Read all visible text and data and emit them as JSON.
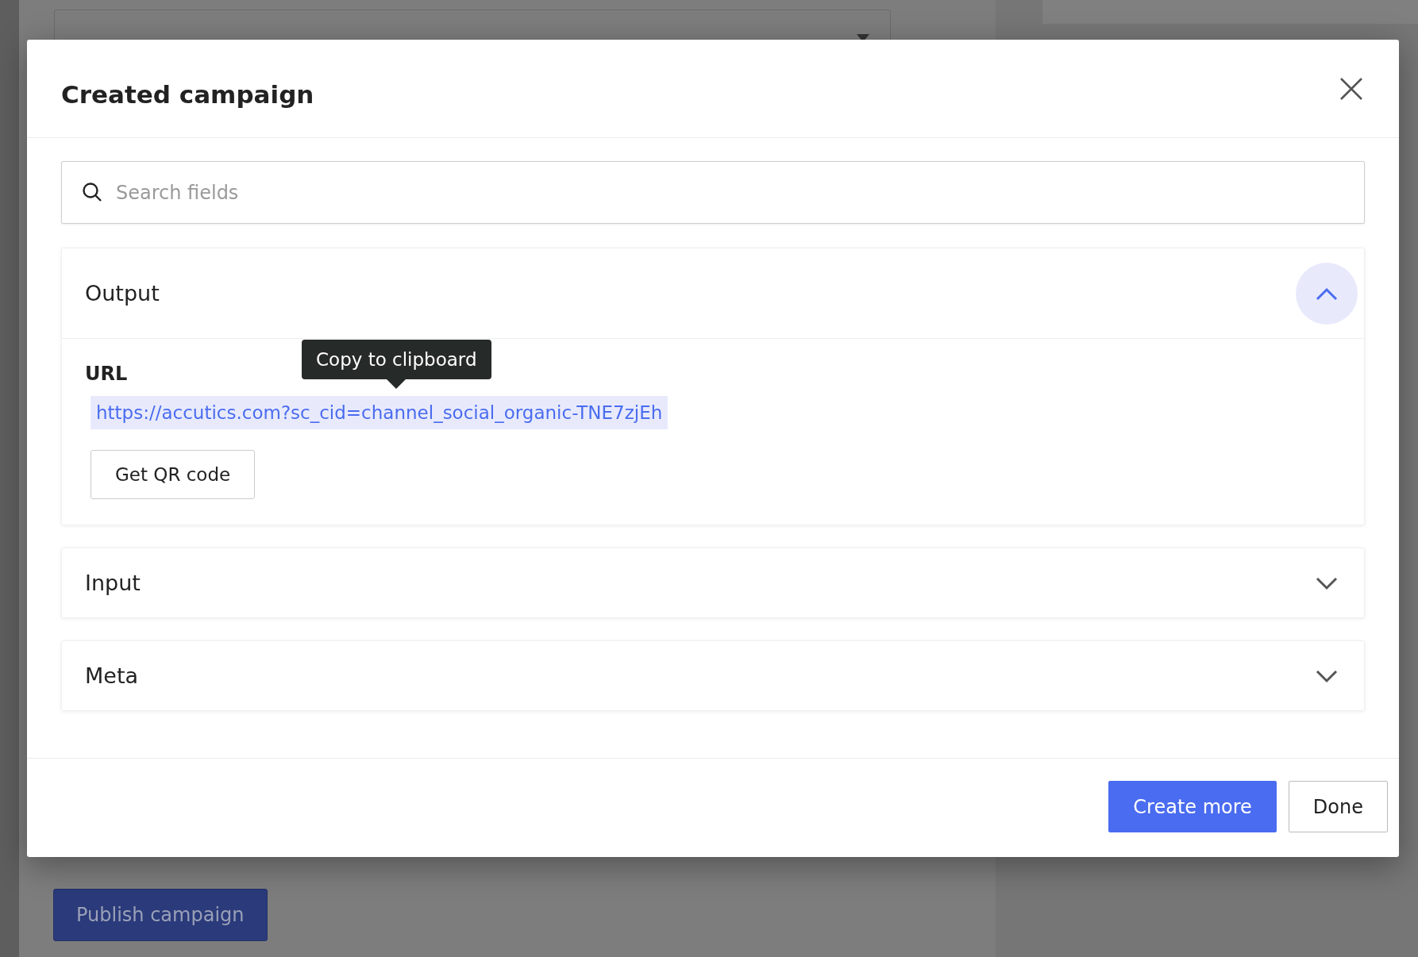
{
  "background": {
    "publish_button": "Publish campaign"
  },
  "dialog": {
    "title": "Created campaign",
    "search": {
      "placeholder": "Search fields"
    },
    "sections": [
      {
        "title": "Output",
        "expanded": true,
        "field_label": "URL",
        "url": "https://accutics.com?sc_cid=channel_social_organic-TNE7zjEh",
        "tooltip": "Copy to clipboard",
        "qr_button": "Get QR code"
      },
      {
        "title": "Input",
        "expanded": false
      },
      {
        "title": "Meta",
        "expanded": false
      }
    ],
    "buttons": [
      {
        "label": "Create more",
        "kind": "primary"
      },
      {
        "label": "Done",
        "kind": "secondary"
      }
    ]
  }
}
